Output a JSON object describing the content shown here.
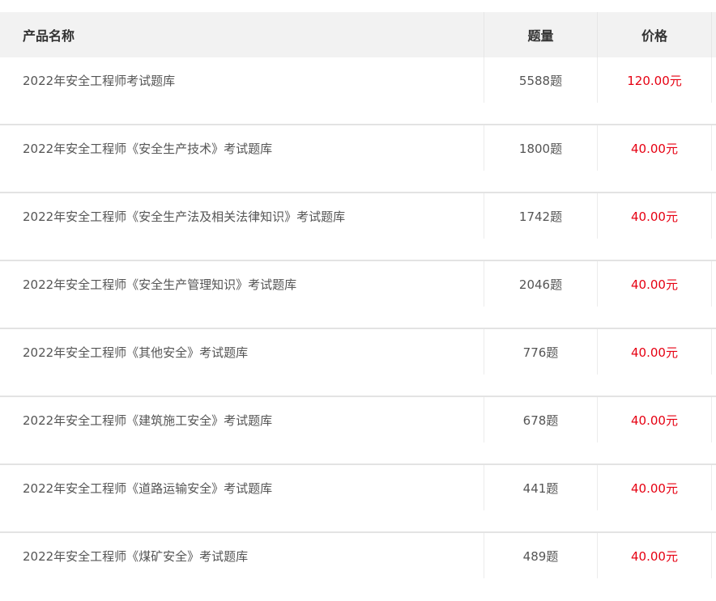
{
  "header": {
    "name": "产品名称",
    "count": "题量",
    "price": "价格"
  },
  "rows": [
    {
      "name": "2022年安全工程师考试题库",
      "count": "5588题",
      "price": "120.00元"
    },
    {
      "name": "2022年安全工程师《安全生产技术》考试题库",
      "count": "1800题",
      "price": "40.00元"
    },
    {
      "name": "2022年安全工程师《安全生产法及相关法律知识》考试题库",
      "count": "1742题",
      "price": "40.00元"
    },
    {
      "name": "2022年安全工程师《安全生产管理知识》考试题库",
      "count": "2046题",
      "price": "40.00元"
    },
    {
      "name": "2022年安全工程师《其他安全》考试题库",
      "count": "776题",
      "price": "40.00元"
    },
    {
      "name": "2022年安全工程师《建筑施工安全》考试题库",
      "count": "678题",
      "price": "40.00元"
    },
    {
      "name": "2022年安全工程师《道路运输安全》考试题库",
      "count": "441题",
      "price": "40.00元"
    },
    {
      "name": "2022年安全工程师《煤矿安全》考试题库",
      "count": "489题",
      "price": "40.00元"
    }
  ],
  "colors": {
    "header_bg": "#f2f2f2",
    "price_red": "#e60012",
    "text": "#555555"
  }
}
